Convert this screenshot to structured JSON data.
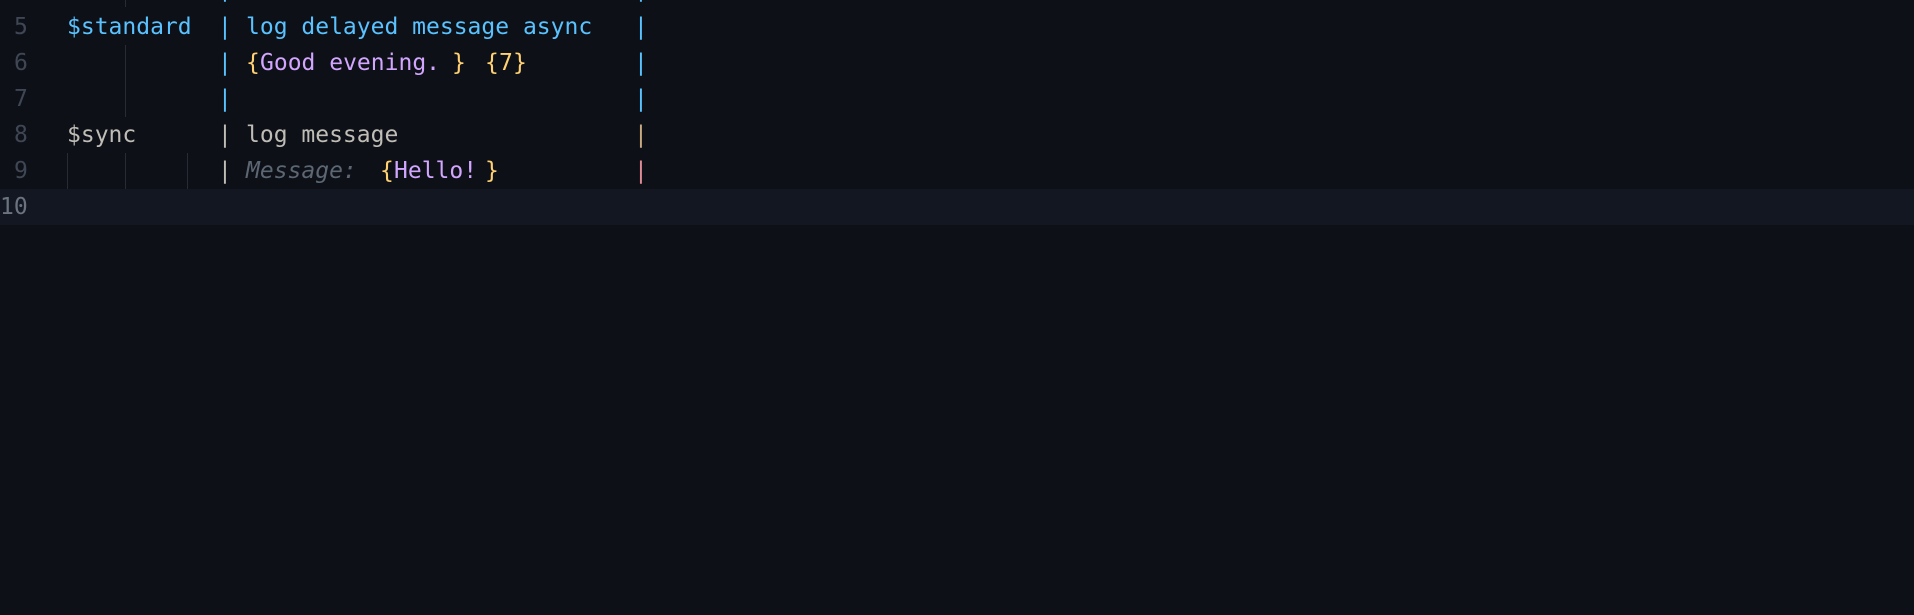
{
  "editor": {
    "line_numbers": [
      "5",
      "6",
      "7",
      "8",
      "9",
      "10"
    ],
    "lines": {
      "l4": {
        "pipe": "|",
        "brace_a": "{",
        "brace_b": "}",
        "brace_c": "{",
        "brace_d": "}",
        "pipe_end": "|"
      },
      "l5": {
        "scenario": "$standard",
        "pipe": "|",
        "step": "log delayed message async",
        "pipe_end": "|"
      },
      "l6": {
        "pipe": "|",
        "open_1": "{",
        "arg_1": "Good evening.",
        "close_1": "}",
        "open_2": "{",
        "arg_2": "7",
        "pipe_end": "|"
      },
      "l7": {
        "pipe": "|",
        "pipe_end": "|"
      },
      "l8": {
        "scenario": "$sync",
        "pipe": "|",
        "step": "log message",
        "pipe_end": "|"
      },
      "l9": {
        "pipe": "|",
        "hint": "Message:",
        "open": "{",
        "arg": "Hello!",
        "close": "}",
        "pipe_end": "|"
      }
    }
  },
  "colors": {
    "background": "#0d1017",
    "current_line": "#131721",
    "scenario_blue": "#59c2ff",
    "brace_yellow": "#ffd173",
    "argument_purple": "#d2a6ff",
    "hint_gray": "#5c6773",
    "plain_text": "#bfbdb6"
  }
}
